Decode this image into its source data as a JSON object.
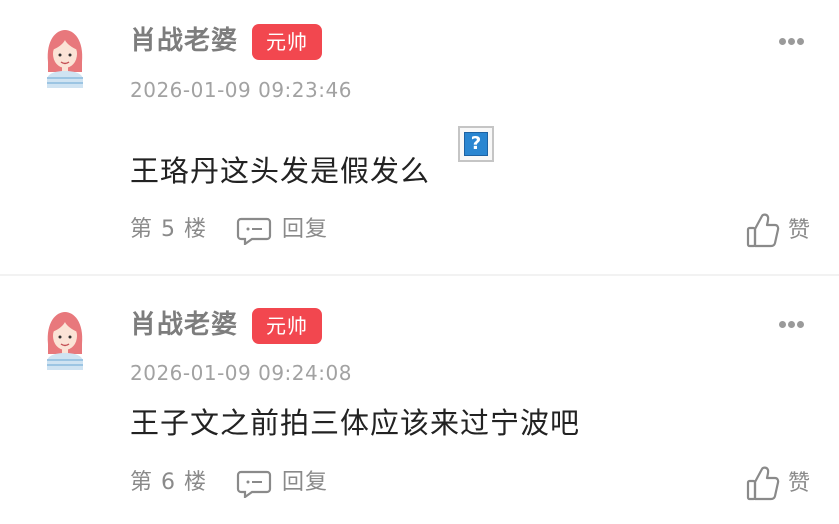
{
  "colors": {
    "badge_bg": "#f2474f",
    "meta_text": "#8a8a8a",
    "username_text": "#7d7d7d"
  },
  "comments": [
    {
      "username": "肖战老婆",
      "badge": "元帅",
      "timestamp": "2026-01-09 09:23:46",
      "content": "王珞丹这头发是假发么",
      "inline_image": "missing-image-placeholder-icon",
      "inline_image_glyph": "?",
      "floor": "第 5 楼",
      "reply_label": "回复",
      "like_label": "赞",
      "avatar": "girl-avatar-icon",
      "more_icon": "more-dots-icon"
    },
    {
      "username": "肖战老婆",
      "badge": "元帅",
      "timestamp": "2026-01-09 09:24:08",
      "content": "王子文之前拍三体应该来过宁波吧",
      "floor": "第 6 楼",
      "reply_label": "回复",
      "like_label": "赞",
      "avatar": "girl-avatar-icon",
      "more_icon": "more-dots-icon"
    }
  ]
}
